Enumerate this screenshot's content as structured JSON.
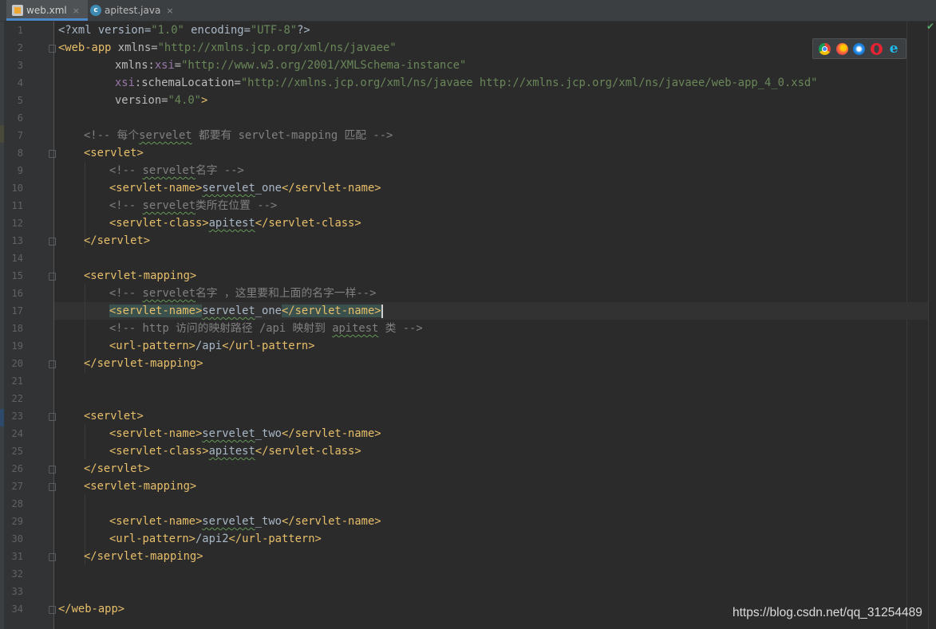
{
  "tabs": [
    {
      "label": "web.xml",
      "icon": "xml-file-icon",
      "close": "×",
      "active": true
    },
    {
      "label": "apitest.java",
      "icon": "java-class-icon",
      "close": "×",
      "active": false
    }
  ],
  "line_numbers": [
    "1",
    "2",
    "3",
    "4",
    "5",
    "6",
    "7",
    "8",
    "9",
    "10",
    "11",
    "12",
    "13",
    "14",
    "15",
    "16",
    "17",
    "18",
    "19",
    "20",
    "21",
    "22",
    "23",
    "24",
    "25",
    "26",
    "27",
    "28",
    "29",
    "30",
    "31",
    "32",
    "33",
    "34"
  ],
  "code": {
    "l1": {
      "p1": "<?xml version=",
      "v1": "\"1.0\"",
      "p2": " encoding=",
      "v2": "\"UTF-8\"",
      "p3": "?>"
    },
    "l2": {
      "tag": "<web-app",
      "attr": " xmlns=",
      "val": "\"http://xmlns.jcp.org/xml/ns/javaee\""
    },
    "l3": {
      "attr1": "xmlns:",
      "ns": "xsi",
      "eq": "=",
      "val": "\"http://www.w3.org/2001/XMLSchema-instance\""
    },
    "l4": {
      "ns": "xsi",
      "attr": ":schemaLocation=",
      "val": "\"http://xmlns.jcp.org/xml/ns/javaee http://xmlns.jcp.org/xml/ns/javaee/web-app_4_0.xsd\""
    },
    "l5": {
      "attr": "version=",
      "val": "\"4.0\"",
      "end": ">"
    },
    "l7": {
      "c1": "<!-- 每个",
      "c2": "servelet",
      "c3": " 都要有 servlet-mapping 匹配 -->"
    },
    "l8": "<servlet>",
    "l9": {
      "c1": "<!-- ",
      "c2": "servelet",
      "c3": "名字 -->"
    },
    "l10": {
      "open": "<servlet-name>",
      "c1": "servelet",
      "c2": "_one",
      "close": "</servlet-name>"
    },
    "l11": {
      "c1": "<!-- ",
      "c2": "servelet",
      "c3": "类所在位置 -->"
    },
    "l12": {
      "open": "<servlet-class>",
      "text": "apitest",
      "close": "</servlet-class>"
    },
    "l13": "</servlet>",
    "l15": "<servlet-mapping>",
    "l16": {
      "c1": "<!-- ",
      "c2": "servelet",
      "c3": "名字 ，这里要和上面的名字一样-->"
    },
    "l17": {
      "open": "<servlet-name>",
      "c1": "servelet",
      "c2": "_one",
      "close": "</servlet-name>"
    },
    "l18": {
      "c1": "<!-- http 访问的映射路径 /api 映射到 ",
      "c2": "apitest",
      "c3": " 类 -->"
    },
    "l19": {
      "open": "<url-pattern>",
      "text": "/api",
      "close": "</url-pattern>"
    },
    "l20": "</servlet-mapping>",
    "l23": "<servlet>",
    "l24": {
      "open": "<servlet-name>",
      "c1": "servelet",
      "c2": "_two",
      "close": "</servlet-name>"
    },
    "l25": {
      "open": "<servlet-class>",
      "text": "apitest",
      "close": "</servlet-class>"
    },
    "l26": "</servlet>",
    "l27": "<servlet-mapping>",
    "l29": {
      "open": "<servlet-name>",
      "c1": "servelet",
      "c2": "_two",
      "close": "</servlet-name>"
    },
    "l30": {
      "open": "<url-pattern>",
      "text": "/api2",
      "close": "</url-pattern>"
    },
    "l31": "</servlet-mapping>",
    "l34": "</web-app>"
  },
  "browser_icons": [
    "chrome-icon",
    "firefox-icon",
    "safari-icon",
    "opera-icon",
    "internet-explorer-icon"
  ],
  "ie_glyph": "e",
  "inspection_status": "✔",
  "watermark": "https://blog.csdn.net/qq_31254489",
  "colors": {
    "background": "#2b2b2b",
    "tag": "#e8bf6a",
    "string": "#6a8759",
    "comment": "#808080",
    "namespace": "#9876aa",
    "text": "#a9b7c6"
  }
}
